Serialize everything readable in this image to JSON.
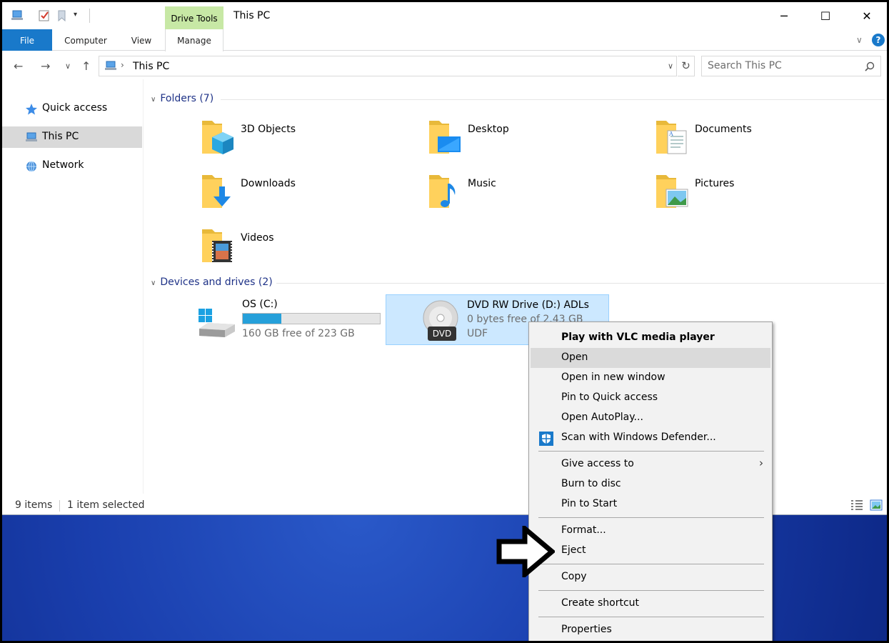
{
  "window": {
    "title": "This PC",
    "contextual_tab": "Drive Tools",
    "controls": {
      "minimize": "─",
      "maximize": "☐",
      "close": "✕"
    }
  },
  "ribbon": {
    "tabs": [
      "File",
      "Computer",
      "View",
      "Manage"
    ]
  },
  "address": {
    "path": "This PC",
    "search_placeholder": "Search This PC"
  },
  "navpane": {
    "items": [
      {
        "label": "Quick access",
        "icon": "star-icon"
      },
      {
        "label": "This PC",
        "icon": "computer-icon"
      },
      {
        "label": "Network",
        "icon": "network-icon"
      }
    ]
  },
  "folders": {
    "header": "Folders (7)",
    "items": [
      {
        "name": "3D Objects",
        "icon": "3d-objects-folder-icon"
      },
      {
        "name": "Desktop",
        "icon": "desktop-folder-icon"
      },
      {
        "name": "Documents",
        "icon": "documents-folder-icon"
      },
      {
        "name": "Downloads",
        "icon": "downloads-folder-icon"
      },
      {
        "name": "Music",
        "icon": "music-folder-icon"
      },
      {
        "name": "Pictures",
        "icon": "pictures-folder-icon"
      },
      {
        "name": "Videos",
        "icon": "videos-folder-icon"
      }
    ]
  },
  "drives": {
    "header": "Devices and drives (2)",
    "items": [
      {
        "name": "OS (C:)",
        "free": "160 GB free of 223 GB",
        "used_fraction": 0.28
      },
      {
        "name": "DVD RW Drive (D:) ADLs",
        "free": "0 bytes free of 2.43 GB",
        "fs": "UDF",
        "badge": "DVD"
      }
    ]
  },
  "status": {
    "items": "9 items",
    "selected": "1 item selected"
  },
  "context_menu": {
    "items": [
      "Play with VLC media player",
      "Open",
      "Open in new window",
      "Pin to Quick access",
      "Open AutoPlay...",
      "Scan with Windows Defender...",
      "Give access to",
      "Burn to disc",
      "Pin to Start",
      "Format...",
      "Eject",
      "Copy",
      "Create shortcut",
      "Properties"
    ]
  },
  "colors": {
    "accent": "#1979ca",
    "selection": "#cce8ff",
    "drive_bar": "#26a0da",
    "contextual_tab": "#c7e8a5"
  }
}
